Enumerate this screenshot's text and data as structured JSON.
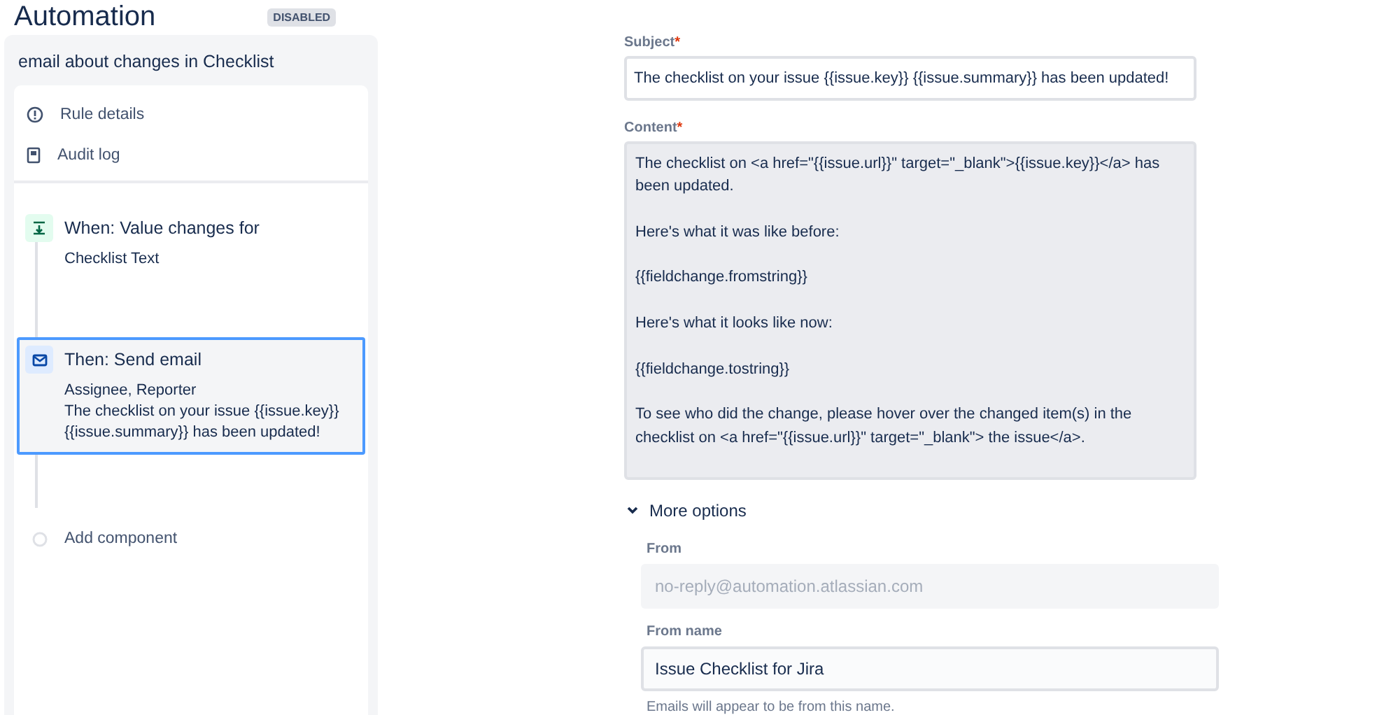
{
  "page": {
    "title": "Automation",
    "badge": "DISABLED"
  },
  "rule": {
    "name": "email about changes in Checklist",
    "menu": [
      {
        "label": "Rule details",
        "kind": "info"
      },
      {
        "label": "Audit log",
        "kind": "log"
      }
    ],
    "steps": [
      {
        "kind": "trigger",
        "title": "When: Value changes for",
        "lines": [
          "Checklist Text"
        ],
        "selected": false
      },
      {
        "kind": "action",
        "title": "Then: Send email",
        "lines": [
          "Assignee, Reporter",
          "The checklist on your issue {{issue.key}} {{issue.summary}} has been updated!"
        ],
        "selected": true
      },
      {
        "kind": "add",
        "title": "Add component",
        "selected": false
      }
    ]
  },
  "form": {
    "subject": {
      "label": "Subject",
      "marker": "*",
      "value": "The checklist on your issue {{issue.key}} {{issue.summary}} has been updated!"
    },
    "content": {
      "label": "Content",
      "marker": "*",
      "value": "The checklist on <a href=\"{{issue.url}}\" target=\"_blank\">{{issue.key}}</a> has been updated.\n\nHere's what it was like before:\n\n{{fieldchange.fromstring}}\n\nHere's what it looks like now:\n\n{{fieldchange.tostring}}\n\nTo see who did the change, please hover over the changed item(s) in the checklist on <a href=\"{{issue.url}}\" target=\"_blank\"> the issue</a>."
    },
    "more_options": {
      "label": "More options",
      "expanded": true
    },
    "from": {
      "label": "From",
      "placeholder": "no-reply@automation.atlassian.com",
      "disabled": true
    },
    "from_name": {
      "label": "From name",
      "value": "Issue Checklist for Jira",
      "help": "Emails will appear to be from this name."
    }
  }
}
